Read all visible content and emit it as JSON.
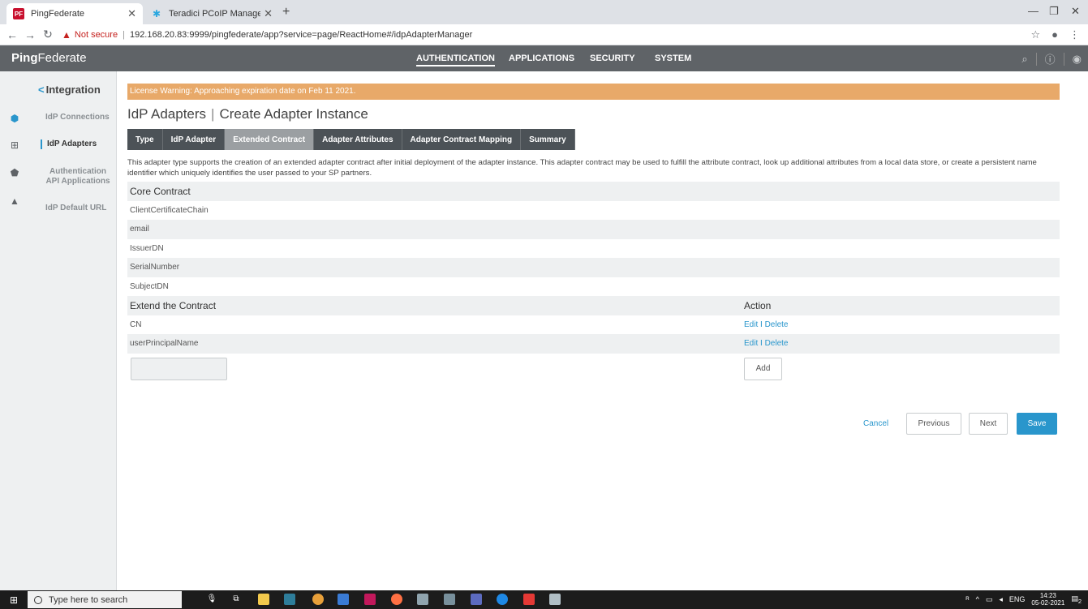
{
  "browser": {
    "tabs": [
      {
        "title": "PingFederate",
        "favicon": "PF"
      },
      {
        "title": "Teradici PCoIP Management Con"
      }
    ],
    "security_label": "Not secure",
    "url": "192.168.20.83:9999/pingfederate/app?service=page/ReactHome#/idpAdapterManager"
  },
  "header": {
    "logo_bold": "Ping",
    "logo_rest": "Federate",
    "nav": [
      "AUTHENTICATION",
      "APPLICATIONS",
      "SECURITY",
      "SYSTEM"
    ]
  },
  "sidebar": {
    "back_label": "Integration",
    "items": [
      "IdP Connections",
      "IdP Adapters",
      "Authentication API Applications",
      "IdP Default URL"
    ]
  },
  "main": {
    "license_warning": "License Warning: Approaching expiration date on Feb 11 2021.",
    "title_part1": "IdP Adapters",
    "title_part2": "Create Adapter Instance",
    "steps": [
      "Type",
      "IdP Adapter",
      "Extended Contract",
      "Adapter Attributes",
      "Adapter Contract Mapping",
      "Summary"
    ],
    "description": "This adapter type supports the creation of an extended adapter contract after initial deployment of the adapter instance. This adapter contract may be used to fulfill the attribute contract, look up additional attributes from a local data store, or create a persistent name identifier which uniquely identifies the user passed to your SP partners.",
    "core_header": "Core Contract",
    "core_items": [
      "ClientCertificateChain",
      "email",
      "IssuerDN",
      "SerialNumber",
      "SubjectDN"
    ],
    "extend_header": "Extend the Contract",
    "action_header": "Action",
    "extended_items": [
      "CN",
      "userPrincipalName"
    ],
    "edit_delete": "Edit I Delete",
    "add_label": "Add",
    "cancel_label": "Cancel",
    "previous_label": "Previous",
    "next_label": "Next",
    "save_label": "Save"
  },
  "taskbar": {
    "search_placeholder": "Type here to search",
    "language": "ENG",
    "time": "14:23",
    "date": "05-02-2021",
    "notification_count": "2"
  },
  "colors": {
    "accent": "#2996cc",
    "header_bg": "#5f6367",
    "license_bg": "#e8a969",
    "step_bg": "#4c5257",
    "step_current": "#9b9fa2"
  }
}
